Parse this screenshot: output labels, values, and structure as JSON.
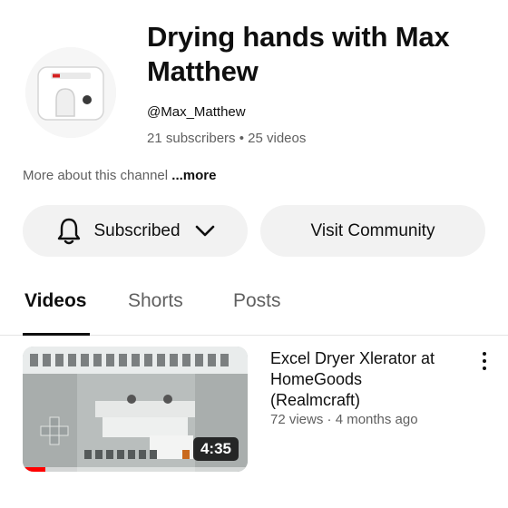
{
  "channel": {
    "title": "Drying hands with Max Matthew",
    "handle": "@Max_Matthew",
    "stats": "21 subscribers • 25 videos",
    "about_text": "More about this channel ",
    "about_more": "...more",
    "avatar_icon": "hand-dryer-icon"
  },
  "actions": {
    "subscribed_label": "Subscribed",
    "visit_label": "Visit Community"
  },
  "tabs": [
    {
      "label": "Videos",
      "active": true
    },
    {
      "label": "Shorts",
      "active": false
    },
    {
      "label": "Posts",
      "active": false
    }
  ],
  "videos": [
    {
      "title": "Excel Dryer Xlerator at HomeGoods (Realmcraft)",
      "meta": "72 views · 4 months ago",
      "duration": "4:35",
      "watched_fraction": 0.1
    }
  ],
  "colors": {
    "accent": "#ff0000",
    "button_bg": "#f2f2f2",
    "secondary_text": "#606060"
  }
}
